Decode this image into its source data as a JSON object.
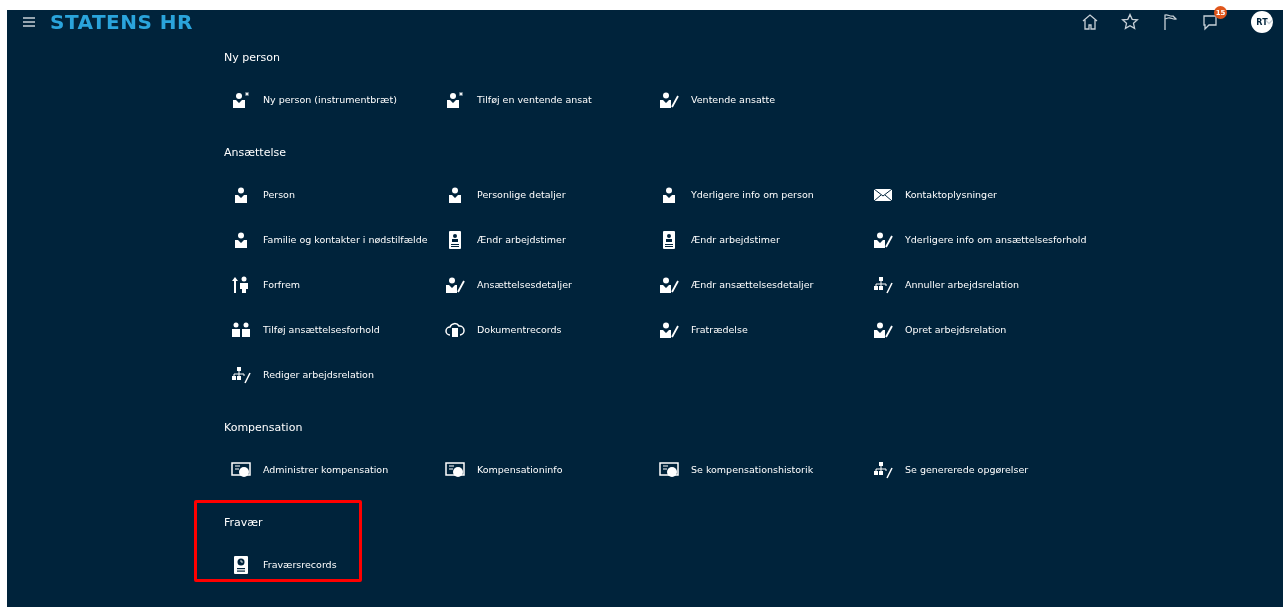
{
  "header": {
    "title": "STATENS HR",
    "notifications_badge": "15",
    "avatar_initials": "RT"
  },
  "sections": [
    {
      "title": "Ny person",
      "highlighted": false,
      "items": [
        {
          "label": "Ny person (instrumentbræt)",
          "kind": "person-new"
        },
        {
          "label": "Tilføj en ventende ansat",
          "kind": "person-new"
        },
        {
          "label": "Ventende ansatte",
          "kind": "person-edit"
        }
      ]
    },
    {
      "title": "Ansættelse",
      "highlighted": false,
      "items": [
        {
          "label": "Person",
          "kind": "person"
        },
        {
          "label": "Personlige detaljer",
          "kind": "person"
        },
        {
          "label": "Yderligere info om person",
          "kind": "person"
        },
        {
          "label": "Kontaktoplysninger",
          "kind": "envelope"
        },
        {
          "label": "Familie og kontakter i nødstilfælde",
          "kind": "person"
        },
        {
          "label": "Ændr arbejdstimer",
          "kind": "badge"
        },
        {
          "label": "Ændr arbejdstimer",
          "kind": "badge"
        },
        {
          "label": "Yderligere info om ansættelsesforhold",
          "kind": "person-edit"
        },
        {
          "label": "Forfrem",
          "kind": "promote"
        },
        {
          "label": "Ansættelsesdetaljer",
          "kind": "person-edit"
        },
        {
          "label": "Ændr ansættelsesdetaljer",
          "kind": "person-edit"
        },
        {
          "label": "Annuller arbejdsrelation",
          "kind": "org-edit"
        },
        {
          "label": "Tilføj ansættelsesforhold",
          "kind": "people"
        },
        {
          "label": "Dokumentrecords",
          "kind": "cloud-doc"
        },
        {
          "label": "Fratrædelse",
          "kind": "person-edit"
        },
        {
          "label": "Opret arbejdsrelation",
          "kind": "person-edit"
        },
        {
          "label": "Rediger arbejdsrelation",
          "kind": "org-edit"
        }
      ]
    },
    {
      "title": "Kompensation",
      "highlighted": false,
      "items": [
        {
          "label": "Administrer kompensation",
          "kind": "compensation"
        },
        {
          "label": "Kompensationinfo",
          "kind": "compensation"
        },
        {
          "label": "Se kompensationshistorik",
          "kind": "compensation"
        },
        {
          "label": "Se genererede opgørelser",
          "kind": "org-edit"
        }
      ]
    },
    {
      "title": "Fravær",
      "highlighted": true,
      "items": [
        {
          "label": "Fraværsrecords",
          "kind": "absence"
        }
      ]
    }
  ]
}
